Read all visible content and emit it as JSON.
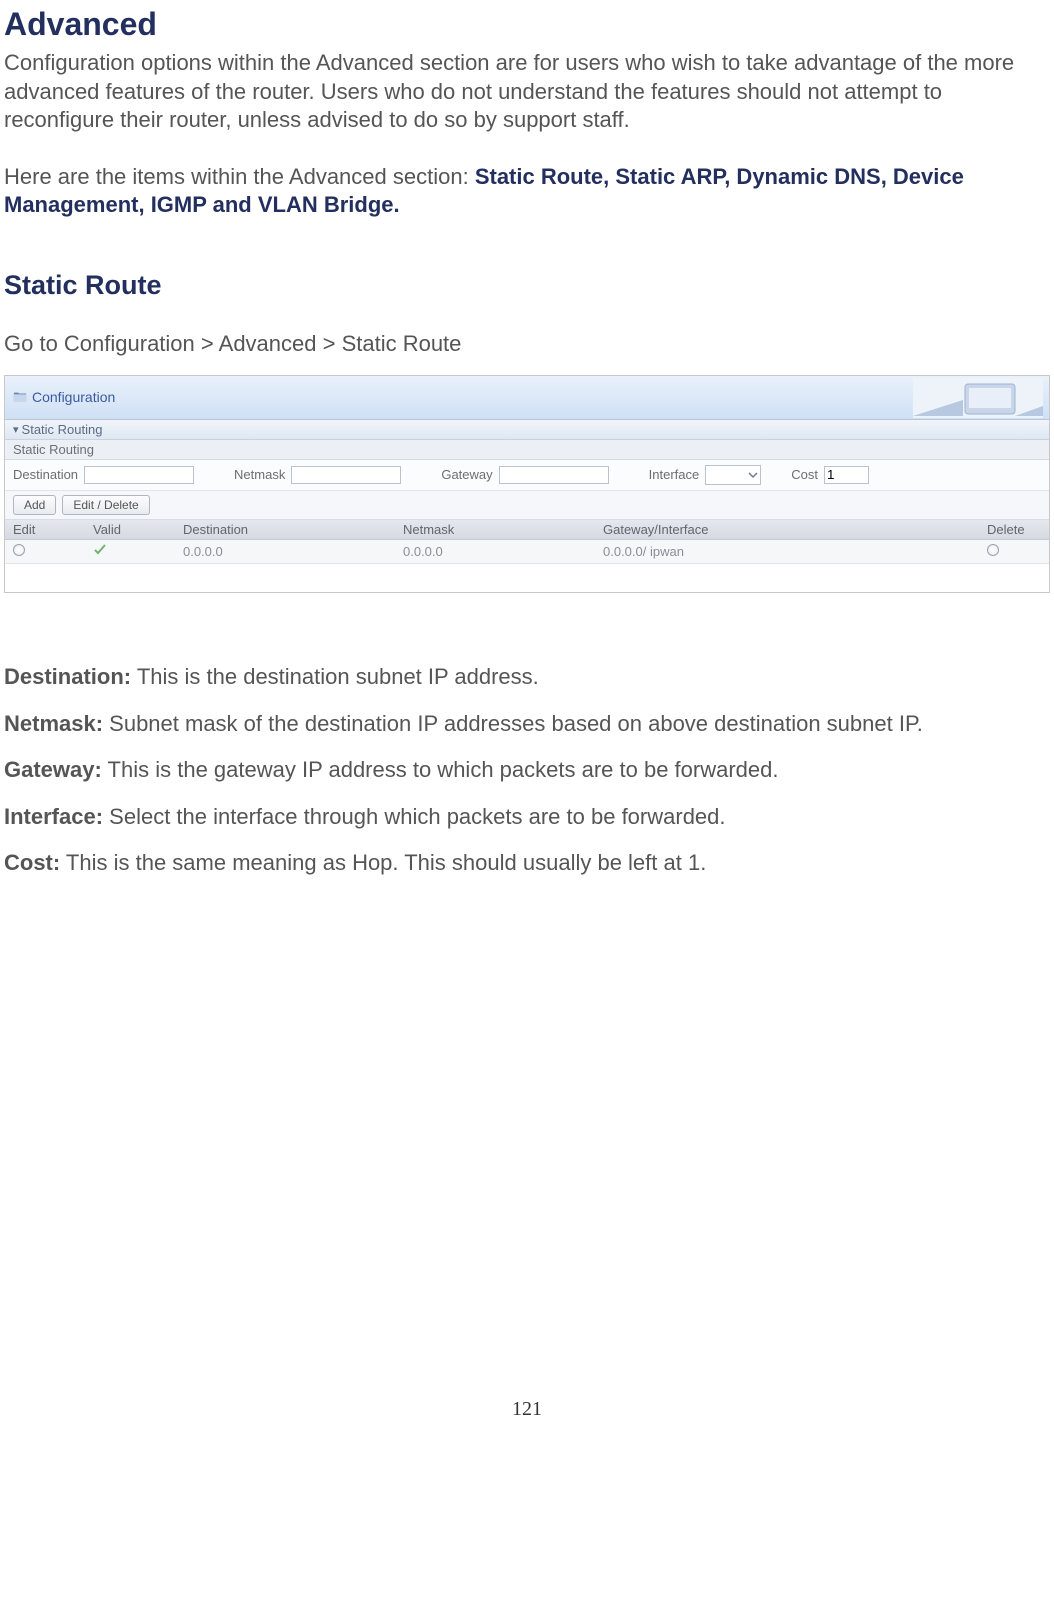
{
  "heading": "Advanced",
  "intro": "Configuration options within the Advanced section are for users who wish to take advantage of the more advanced features of the router. Users who do not understand the features should not attempt to reconfigure their router, unless advised to do so by support staff.",
  "itemsPrefix": "Here are the items within the Advanced section: ",
  "itemsList": "Static Route, Static ARP, Dynamic DNS, Device Management, IGMP and VLAN Bridge.",
  "subheading": "Static Route",
  "path": "Go to Configuration > Advanced > Static Route",
  "panel": {
    "title": "Configuration",
    "section": "Static Routing",
    "subsection": "Static Routing",
    "form": {
      "destinationLabel": "Destination",
      "destinationValue": "",
      "netmaskLabel": "Netmask",
      "netmaskValue": "",
      "gatewayLabel": "Gateway",
      "gatewayValue": "",
      "interfaceLabel": "Interface",
      "interfaceValue": "",
      "costLabel": "Cost",
      "costValue": "1"
    },
    "buttons": {
      "add": "Add",
      "editDelete": "Edit / Delete"
    },
    "columns": {
      "edit": "Edit",
      "valid": "Valid",
      "destination": "Destination",
      "netmask": "Netmask",
      "gatewayInterface": "Gateway/Interface",
      "delete": "Delete"
    },
    "rows": [
      {
        "destination": "0.0.0.0",
        "netmask": "0.0.0.0",
        "gatewayInterface": "0.0.0.0/ ipwan"
      }
    ]
  },
  "defs": {
    "destination": {
      "term": "Destination:",
      "text": " This is the destination subnet IP address."
    },
    "netmask": {
      "term": "Netmask:",
      "text": " Subnet mask of the destination IP addresses based on above destination subnet IP."
    },
    "gateway": {
      "term": "Gateway:",
      "text": " This is the gateway IP address to which packets are to be forwarded."
    },
    "interface": {
      "term": "Interface:",
      "text": " Select the interface through which packets are to be forwarded."
    },
    "cost": {
      "term": "Cost:",
      "text": " This is the same meaning as Hop. This should usually be left at 1."
    }
  },
  "pageNumber": "121"
}
